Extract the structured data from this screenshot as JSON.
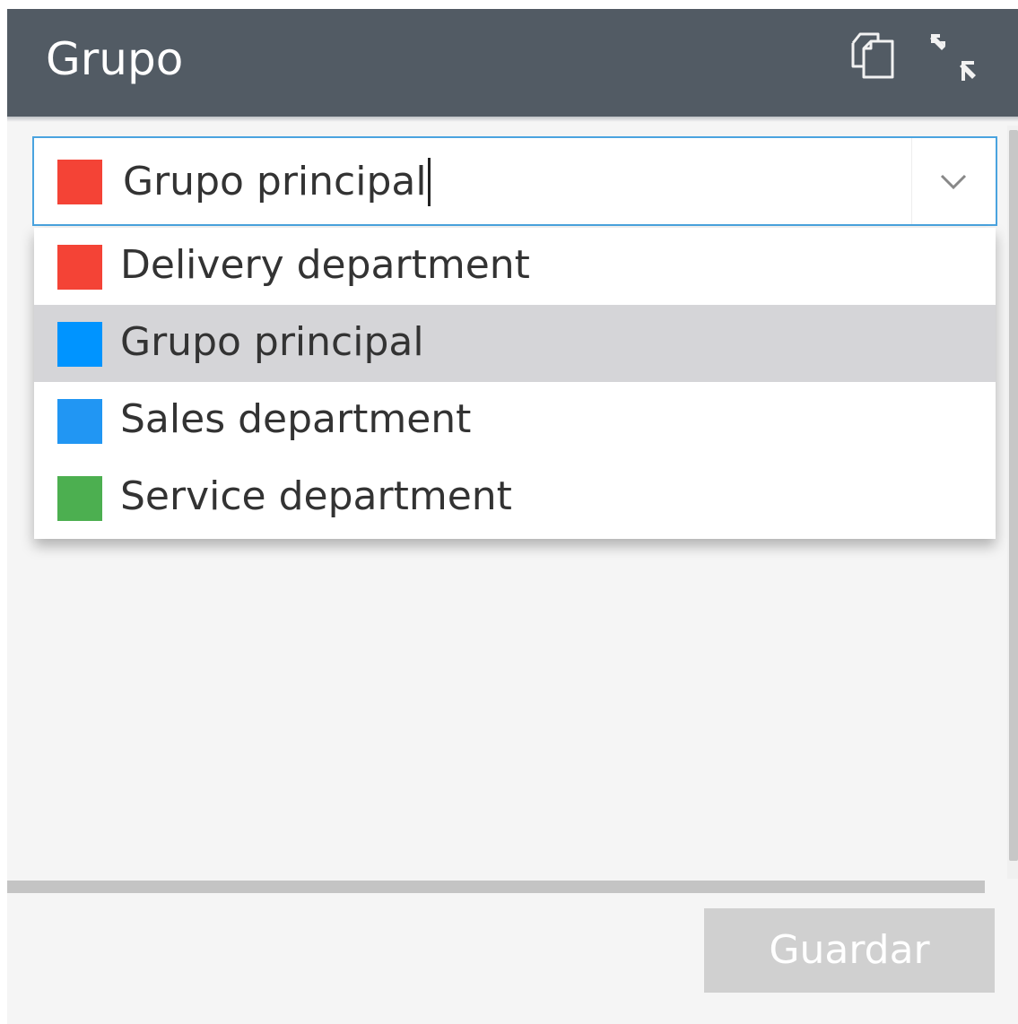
{
  "dialog": {
    "title": "Grupo",
    "header_bg": "#525b64",
    "header_icons": [
      "detach-window-icon",
      "collapse-icon"
    ]
  },
  "group_select": {
    "selected_label": "Grupo principal",
    "selected_color": "#f44336",
    "open": true,
    "icon": "chevron-down-icon",
    "options": [
      {
        "label": "Delivery department",
        "color": "#f44336",
        "highlighted": false
      },
      {
        "label": "Grupo principal",
        "color": "#0094ff",
        "highlighted": true
      },
      {
        "label": "Sales department",
        "color": "#2196f3",
        "highlighted": false
      },
      {
        "label": "Service department",
        "color": "#4caf50",
        "highlighted": false
      }
    ]
  },
  "footer": {
    "save_label": "Guardar",
    "save_enabled": false
  }
}
